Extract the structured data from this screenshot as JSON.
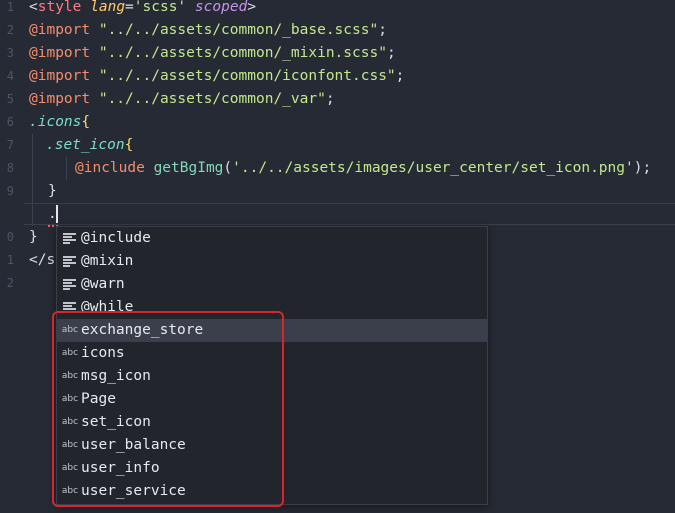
{
  "gutter": {
    "line_numbers": [
      "1",
      "2",
      "3",
      "4",
      "5",
      "6",
      "7",
      "8",
      "9",
      "0",
      "1",
      "2"
    ]
  },
  "code": {
    "line1": {
      "open": "<",
      "tag": "style",
      "attr": "lang",
      "eq": "=",
      "val": "'scss'",
      "scoped": "scoped",
      "close": ">"
    },
    "line2": {
      "kw": "@import",
      "str": "\"../../assets/common/_base.scss\"",
      "semi": ";"
    },
    "line3": {
      "kw": "@import",
      "str": "\"../../assets/common/_mixin.scss\"",
      "semi": ";"
    },
    "line4": {
      "kw": "@import",
      "str": "\"../../assets/common/iconfont.css\"",
      "semi": ";"
    },
    "line5": {
      "kw": "@import",
      "str": "\"../../assets/common/_var\"",
      "semi": ";"
    },
    "line6": {
      "sel": ".icons",
      "brace": "{"
    },
    "line7": {
      "sel": ".set_icon",
      "brace": "{"
    },
    "line8": {
      "kw": "@include",
      "fn": "getBgImg",
      "paren_open": "(",
      "str": "'../../assets/images/user_center/set_icon.png'",
      "paren_close": ");"
    },
    "line9": {
      "brace": "}"
    },
    "line10": {
      "text": "."
    },
    "line11": {
      "brace": "}"
    },
    "line12": {
      "text": "</s"
    }
  },
  "suggestions": {
    "items": [
      {
        "kind": "keyword-icon",
        "label": "@include"
      },
      {
        "kind": "keyword-icon",
        "label": "@mixin"
      },
      {
        "kind": "keyword-icon",
        "label": "@warn"
      },
      {
        "kind": "keyword-icon",
        "label": "@while"
      },
      {
        "kind": "text",
        "badge": "abc",
        "label": "exchange_store",
        "selected": true
      },
      {
        "kind": "text",
        "badge": "abc",
        "label": "icons"
      },
      {
        "kind": "text",
        "badge": "abc",
        "label": "msg_icon"
      },
      {
        "kind": "text",
        "badge": "abc",
        "label": "Page"
      },
      {
        "kind": "text",
        "badge": "abc",
        "label": "set_icon"
      },
      {
        "kind": "text",
        "badge": "abc",
        "label": "user_balance"
      },
      {
        "kind": "text",
        "badge": "abc",
        "label": "user_info"
      },
      {
        "kind": "text",
        "badge": "abc",
        "label": "user_service"
      }
    ]
  },
  "colors": {
    "background": "#262a34",
    "highlight_box": "#d7262b",
    "selected_row": "#3b3f4c"
  }
}
